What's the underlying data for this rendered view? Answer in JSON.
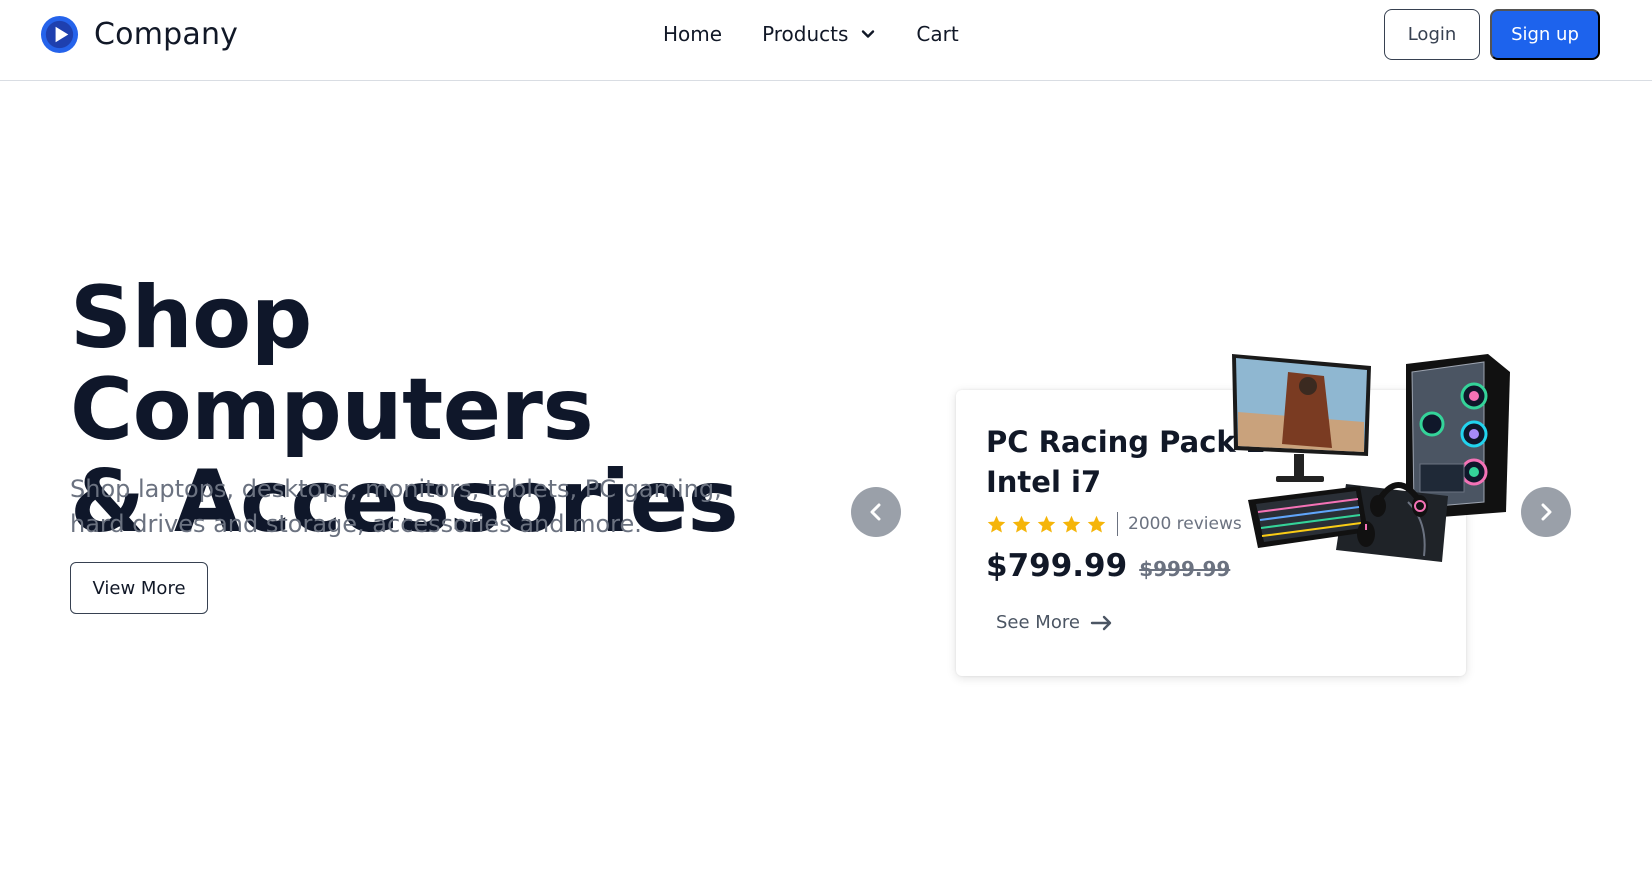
{
  "navbar": {
    "brand": "Company",
    "links": {
      "home": "Home",
      "products": "Products",
      "cart": "Cart"
    },
    "login_label": "Login",
    "signup_label": "Sign up"
  },
  "hero": {
    "title_line1": "Shop Computers",
    "title_line2": "& Accessories",
    "subtitle": "Shop laptops, desktops, monitors, tablets, PC gaming, hard drives and storage, accessories and more.",
    "view_more_label": "View More"
  },
  "product": {
    "title_line1": "PC Racing Pack 2 -",
    "title_line2": "Intel i7",
    "rating": 5,
    "max_rating": 5,
    "reviews": "2000 reviews",
    "price": "$799.99",
    "old_price": "$999.99",
    "see_more_label": "See More"
  },
  "icons": {
    "logo": "play-logo-icon",
    "products_dropdown": "chevron-down-icon",
    "prev": "chevron-left-icon",
    "next": "chevron-right-icon",
    "rating": "star-icon",
    "see_more": "arrow-right-icon"
  },
  "colors": {
    "accent": "#1d63ed",
    "star": "#f5b50a",
    "text_muted": "#6b7280",
    "carousel_arrow": "#9aa0a9"
  }
}
